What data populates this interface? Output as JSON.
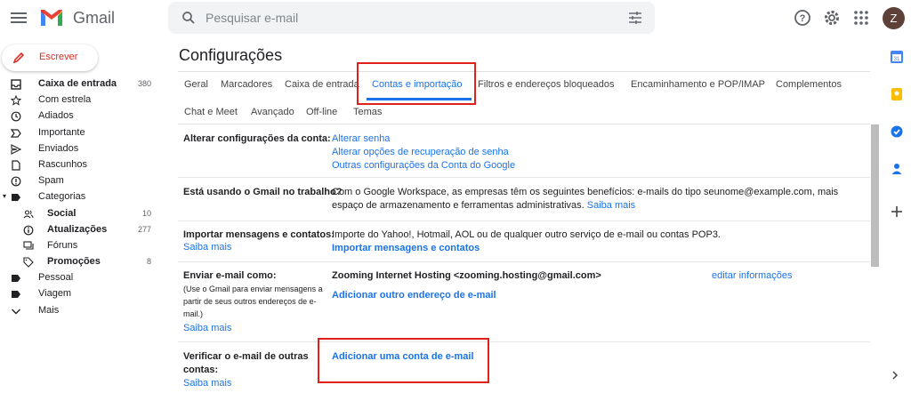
{
  "header": {
    "app_name": "Gmail",
    "search_placeholder": "Pesquisar e-mail",
    "avatar_letter": "Z"
  },
  "compose": {
    "label": "Escrever"
  },
  "sidebar": {
    "items": [
      {
        "label": "Caixa de entrada",
        "count": "380",
        "bold": true,
        "icon": "inbox-icon"
      },
      {
        "label": "Com estrela",
        "count": "",
        "icon": "star-icon"
      },
      {
        "label": "Adiados",
        "count": "",
        "icon": "clock-icon"
      },
      {
        "label": "Importante",
        "count": "",
        "icon": "important-icon"
      },
      {
        "label": "Enviados",
        "count": "",
        "icon": "send-icon"
      },
      {
        "label": "Rascunhos",
        "count": "",
        "icon": "draft-icon"
      },
      {
        "label": "Spam",
        "count": "",
        "icon": "spam-icon"
      },
      {
        "label": "Categorias",
        "count": "",
        "icon": "label-icon"
      },
      {
        "label": "Social",
        "count": "10",
        "bold": true,
        "icon": "people-icon"
      },
      {
        "label": "Atualizações",
        "count": "277",
        "bold": true,
        "icon": "info-icon"
      },
      {
        "label": "Fóruns",
        "count": "",
        "icon": "forum-icon"
      },
      {
        "label": "Promoções",
        "count": "8",
        "bold": true,
        "icon": "tag-icon"
      },
      {
        "label": "Pessoal",
        "count": "",
        "icon": "label-icon"
      },
      {
        "label": "Viagem",
        "count": "",
        "icon": "label-icon"
      },
      {
        "label": "Mais",
        "count": "",
        "icon": "chevron-down-icon"
      }
    ]
  },
  "settings": {
    "title": "Configurações",
    "tabs": [
      "Geral",
      "Marcadores",
      "Caixa de entrada",
      "Contas e importação",
      "Filtros e endereços bloqueados",
      "Encaminhamento e POP/IMAP",
      "Complementos",
      "Chat e Meet",
      "Avançado",
      "Off-line",
      "Temas"
    ],
    "rows": {
      "account": {
        "label": "Alterar configurações da conta:",
        "links": [
          "Alterar senha",
          "Alterar opções de recuperação de senha",
          "Outras configurações da Conta do Google"
        ]
      },
      "work": {
        "label": "Está usando o Gmail no trabalho?",
        "text1": "Com o Google Workspace, as empresas têm os seguintes benefícios: e-mails do tipo seunome@example.com, mais",
        "text2": "espaço de armazenamento e ferramentas administrativas.",
        "help": "Saiba mais"
      },
      "import": {
        "label": "Importar mensagens e contatos:",
        "help": "Saiba mais",
        "text": "Importe do Yahoo!, Hotmail, AOL ou de qualquer outro serviço de e-mail ou contas POP3.",
        "action": "Importar mensagens e contatos"
      },
      "send_as": {
        "label": "Enviar e-mail como:",
        "note": [
          "(Use o Gmail para enviar mensagens a",
          "partir de seus outros endereços de e-",
          "mail.)"
        ],
        "help": "Saiba mais",
        "address": "Zooming Internet Hosting <zooming.hosting@gmail.com>",
        "edit": "editar informações",
        "add": "Adicionar outro endereço de e-mail"
      },
      "check": {
        "label1": "Verificar o e-mail de outras",
        "label2": "contas:",
        "help": "Saiba mais",
        "add": "Adicionar uma conta de e-mail"
      }
    }
  },
  "colors": {
    "accent": "#1a73e8",
    "highlight": "#e0201b",
    "compose_text": "#d93025"
  }
}
